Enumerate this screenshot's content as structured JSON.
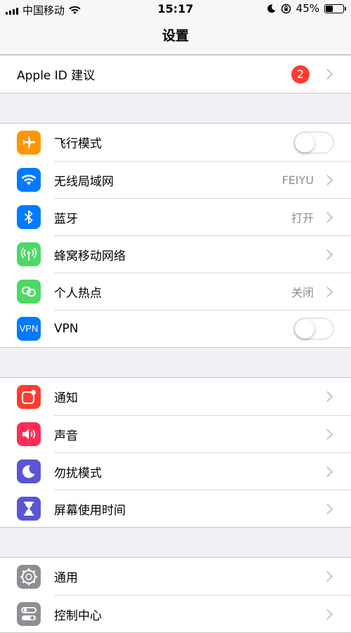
{
  "status_bar": {
    "carrier": "中国移动",
    "time": "15:17",
    "battery_percent": "45%",
    "battery_level": 0.45
  },
  "nav": {
    "title": "设置"
  },
  "apple_id": {
    "label": "Apple ID 建议",
    "badge": "2"
  },
  "group1": [
    {
      "label": "飞行模式",
      "icon": "airplane-icon",
      "color": "#ff9500",
      "control": "toggle",
      "on": false
    },
    {
      "label": "无线局域网",
      "icon": "wifi-icon",
      "color": "#007aff",
      "value": "FEIYU"
    },
    {
      "label": "蓝牙",
      "icon": "bluetooth-icon",
      "color": "#007aff",
      "value": "打开"
    },
    {
      "label": "蜂窝移动网络",
      "icon": "cellular-icon",
      "color": "#4cd964"
    },
    {
      "label": "个人热点",
      "icon": "hotspot-icon",
      "color": "#4cd964",
      "value": "关闭"
    },
    {
      "label": "VPN",
      "icon": "vpn-icon",
      "icon_text": "VPN",
      "color": "#007aff",
      "control": "toggle",
      "on": false
    }
  ],
  "group2": [
    {
      "label": "通知",
      "icon": "notifications-icon",
      "color": "#ff3b30"
    },
    {
      "label": "声音",
      "icon": "sounds-icon",
      "color": "#ff2d55"
    },
    {
      "label": "勿扰模式",
      "icon": "moon-icon",
      "color": "#5856d6"
    },
    {
      "label": "屏幕使用时间",
      "icon": "hourglass-icon",
      "color": "#5856d6"
    }
  ],
  "group3": [
    {
      "label": "通用",
      "icon": "gear-icon",
      "color": "#8e8e93"
    },
    {
      "label": "控制中心",
      "icon": "control-center-icon",
      "color": "#8e8e93"
    }
  ]
}
